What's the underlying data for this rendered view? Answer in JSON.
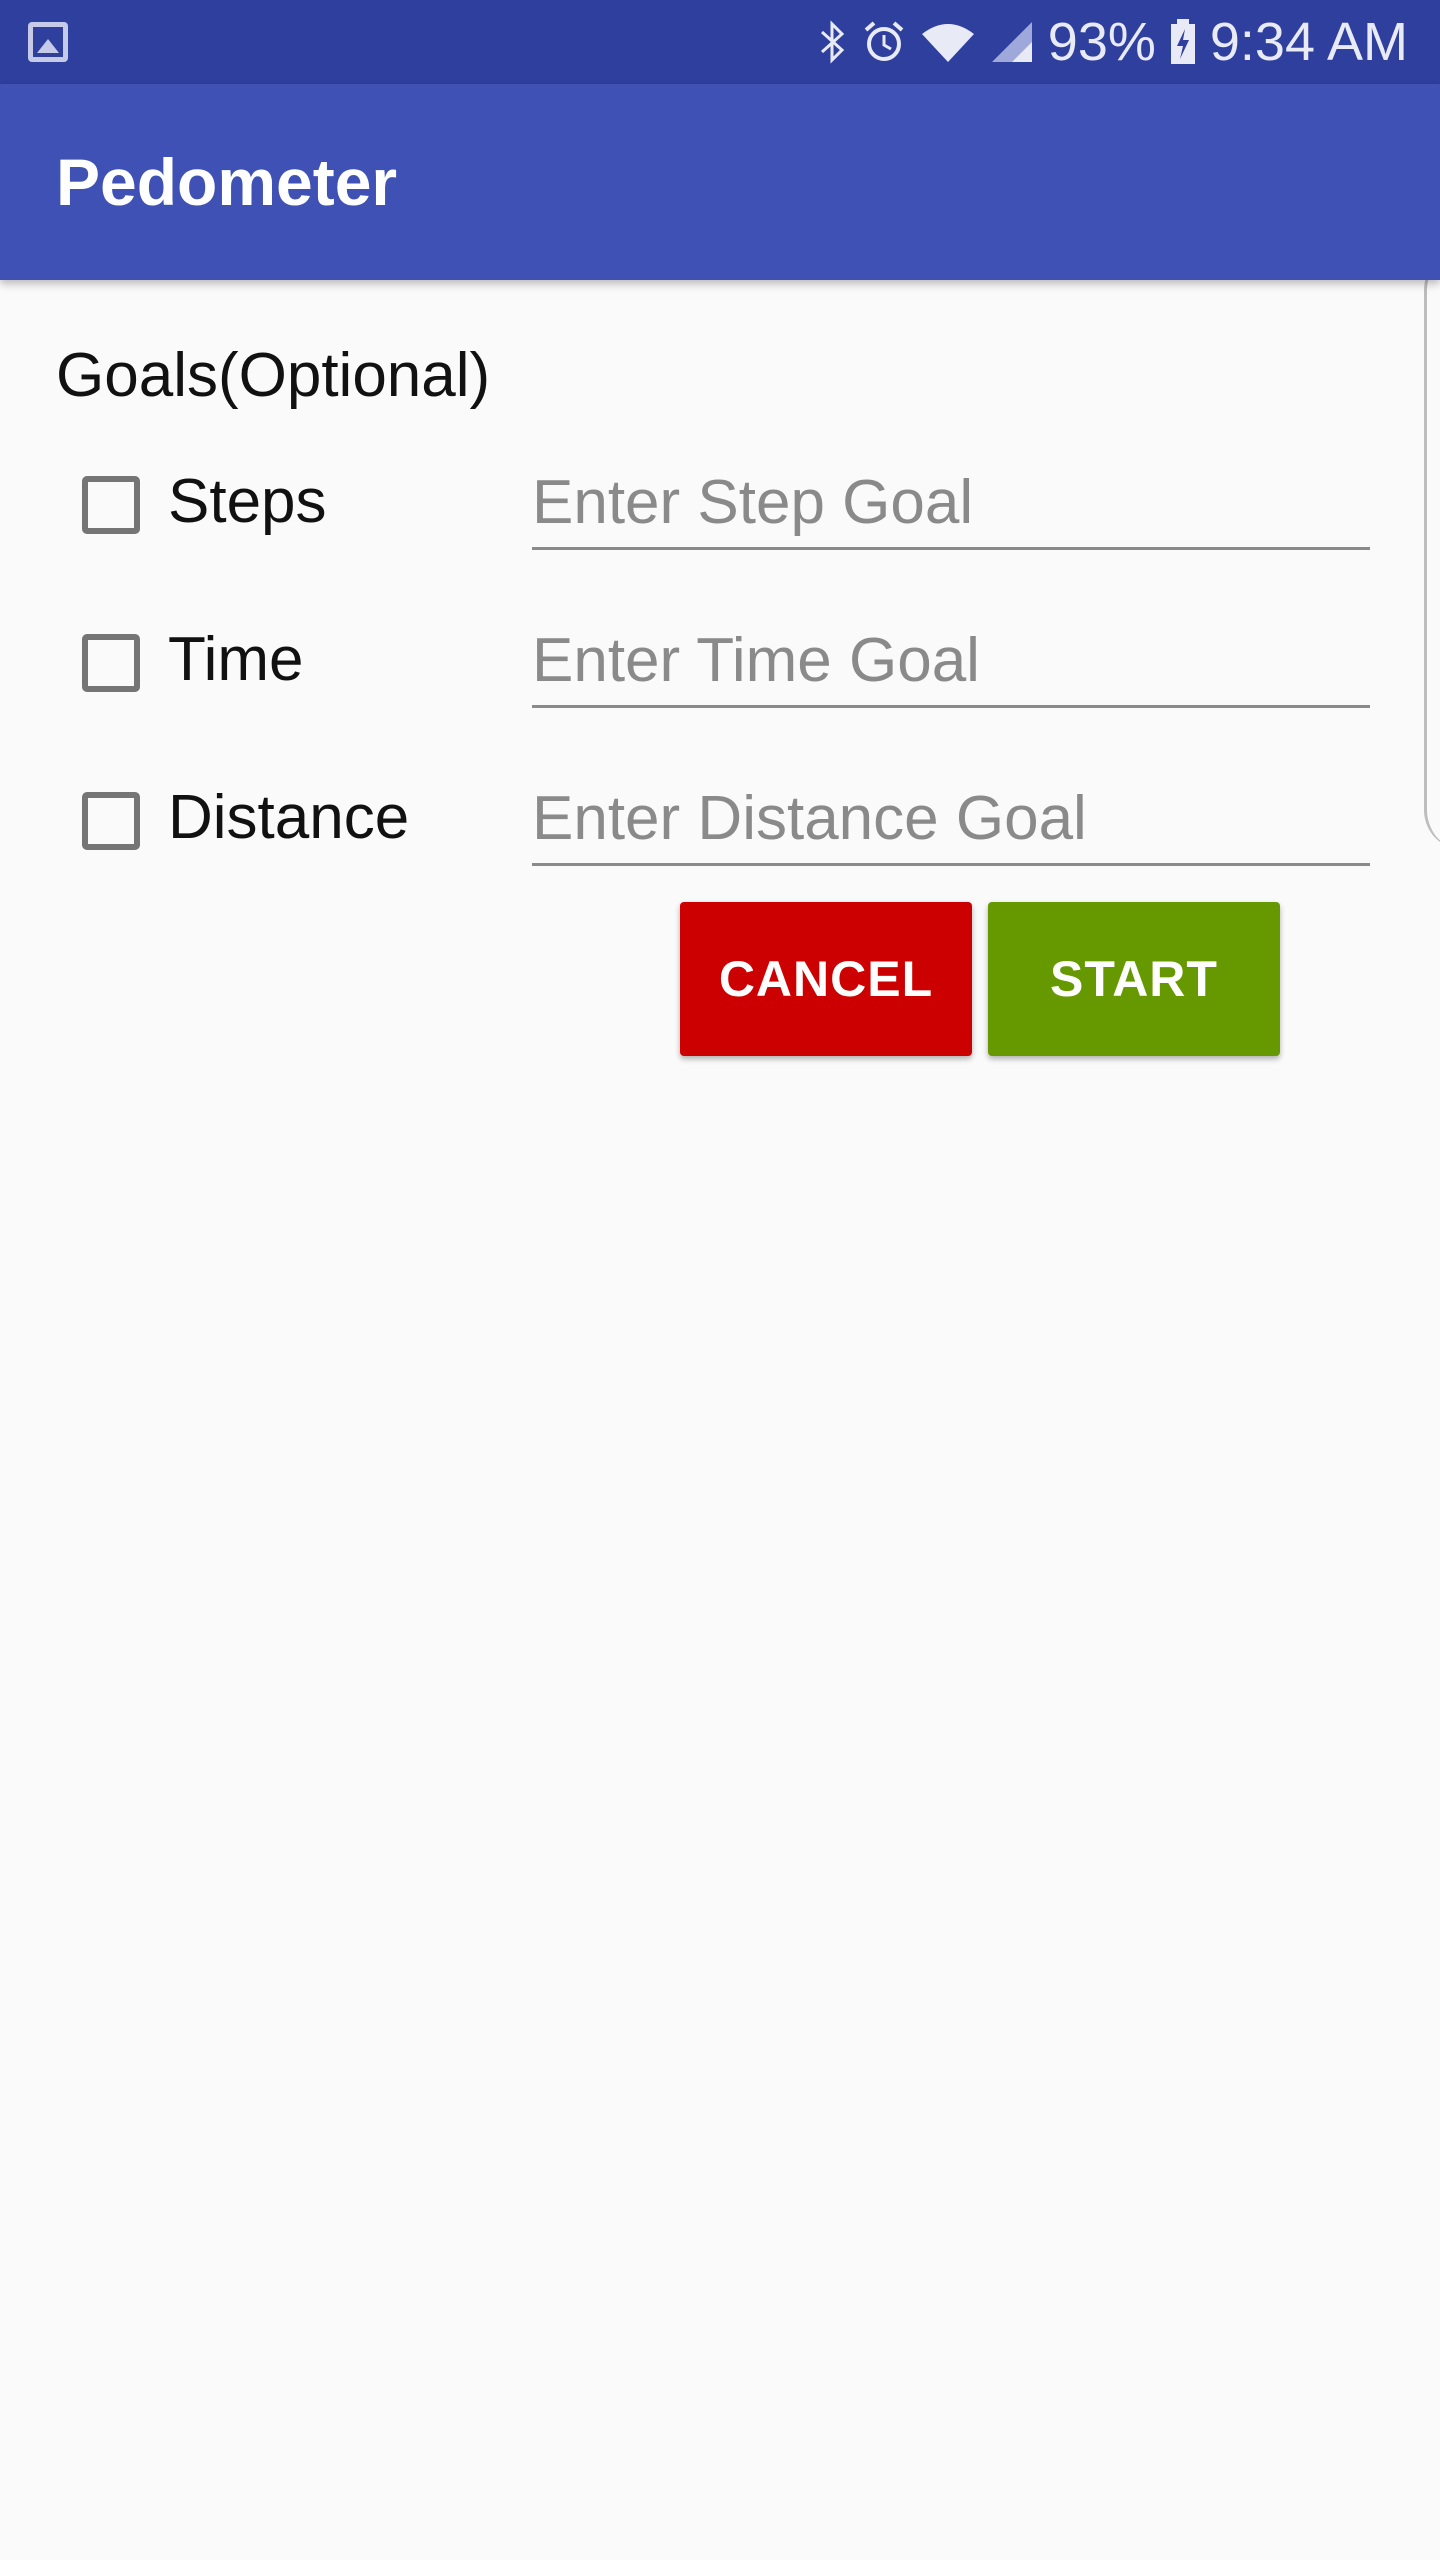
{
  "status_bar": {
    "battery": "93%",
    "time": "9:34 AM",
    "icons": [
      "gallery-icon",
      "bluetooth-icon",
      "alarm-icon",
      "wifi-icon",
      "signal-icon",
      "battery-charging-icon"
    ]
  },
  "app_bar": {
    "title": "Pedometer"
  },
  "form": {
    "section_label": "Goals(Optional)",
    "rows": [
      {
        "label": "Steps",
        "placeholder": "Enter Step Goal",
        "value": "",
        "checked": false
      },
      {
        "label": "Time",
        "placeholder": "Enter Time Goal",
        "value": "",
        "checked": false
      },
      {
        "label": "Distance",
        "placeholder": "Enter Distance Goal",
        "value": "",
        "checked": false
      }
    ],
    "cancel_label": "CANCEL",
    "start_label": "START"
  },
  "colors": {
    "status_bar": "#2f3f9e",
    "app_bar": "#3f51b5",
    "cancel": "#cc0000",
    "start": "#669900",
    "background": "#fafafa"
  }
}
